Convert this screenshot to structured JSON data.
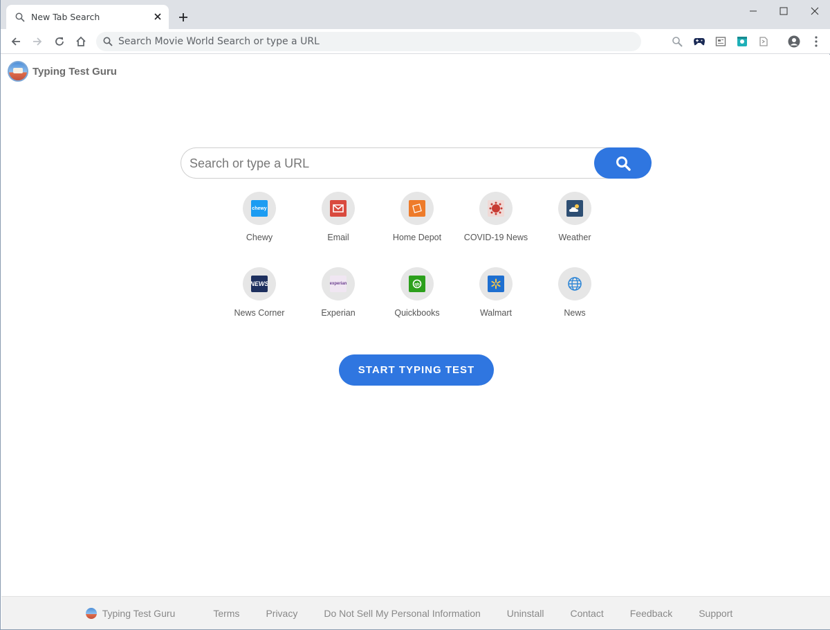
{
  "browser": {
    "tab_title": "New Tab Search",
    "omnibox_placeholder": "Search Movie World Search or type a URL"
  },
  "page": {
    "brand_name": "Typing Test Guru",
    "search": {
      "placeholder": "Search or type a URL",
      "value": ""
    },
    "tiles": [
      {
        "label": "Chewy",
        "icon": "chewy-icon",
        "color": "#1c9cf2"
      },
      {
        "label": "Email",
        "icon": "email-icon",
        "color": "#d94a3e"
      },
      {
        "label": "Home Depot",
        "icon": "home-depot-icon",
        "color": "#ee7b2a"
      },
      {
        "label": "COVID-19 News",
        "icon": "covid-icon",
        "color": "#c73a32"
      },
      {
        "label": "Weather",
        "icon": "weather-icon",
        "color": "#2d4e73"
      },
      {
        "label": "News Corner",
        "icon": "news-corner-icon",
        "color": "#1d2f5e"
      },
      {
        "label": "Experian",
        "icon": "experian-icon",
        "color": "#f0e6f2"
      },
      {
        "label": "Quickbooks",
        "icon": "quickbooks-icon",
        "color": "#2ca01c"
      },
      {
        "label": "Walmart",
        "icon": "walmart-icon",
        "color": "#1e6fd0"
      },
      {
        "label": "News",
        "icon": "globe-icon",
        "color": "#2f86d6"
      }
    ],
    "start_button": "START TYPING TEST",
    "accent_color": "#2f76e0"
  },
  "footer": {
    "brand": "Typing Test Guru",
    "links": [
      "Terms",
      "Privacy",
      "Do Not Sell My Personal Information",
      "Uninstall",
      "Contact",
      "Feedback",
      "Support"
    ]
  }
}
